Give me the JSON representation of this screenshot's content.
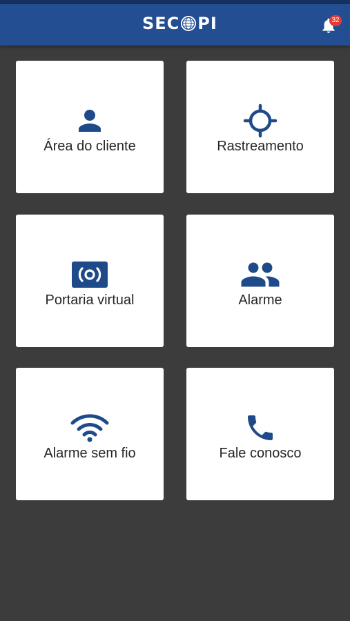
{
  "header": {
    "logo_text_left": "SEC",
    "logo_text_right": "PI",
    "logo_emblem": "globe-emblem-icon",
    "notification_icon": "bell-icon",
    "notification_count": "32",
    "brand_color": "#234e91"
  },
  "menu": {
    "icon_color": "#1f4a8a",
    "tiles": [
      {
        "label": "Área do cliente",
        "icon": "person-icon"
      },
      {
        "label": "Rastreamento",
        "icon": "crosshair-icon"
      },
      {
        "label": "Portaria virtual",
        "icon": "camera-gate-icon"
      },
      {
        "label": "Alarme",
        "icon": "people-icon"
      },
      {
        "label": "Alarme sem fio",
        "icon": "wifi-icon"
      },
      {
        "label": "Fale conosco",
        "icon": "phone-icon"
      }
    ]
  }
}
